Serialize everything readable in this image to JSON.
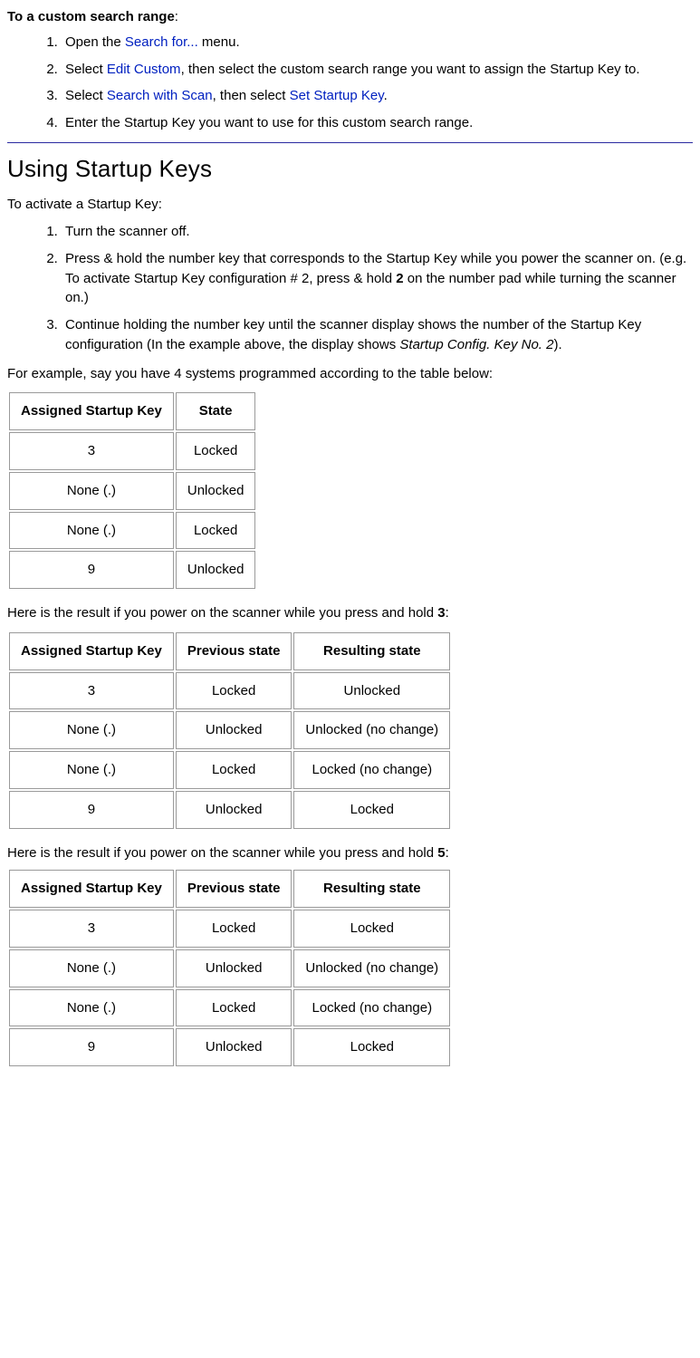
{
  "intro": {
    "heading_prefix": "To a custom search range",
    "heading_colon": ":",
    "steps": [
      {
        "parts": [
          {
            "t": "Open the "
          },
          {
            "t": "Search for...",
            "link": true
          },
          {
            "t": " menu."
          }
        ]
      },
      {
        "parts": [
          {
            "t": "Select "
          },
          {
            "t": "Edit Custom",
            "link": true
          },
          {
            "t": ", then select the custom search range you want to assign the Startup Key to."
          }
        ]
      },
      {
        "parts": [
          {
            "t": "Select "
          },
          {
            "t": "Search with Scan",
            "link": true
          },
          {
            "t": ", then select "
          },
          {
            "t": "Set Startup Key",
            "link": true
          },
          {
            "t": "."
          }
        ]
      },
      {
        "parts": [
          {
            "t": "Enter the Startup Key you want to use for this custom search range."
          }
        ]
      }
    ]
  },
  "section": {
    "title": "Using Startup Keys",
    "lead": "To activate a Startup Key:",
    "steps": [
      {
        "parts": [
          {
            "t": "Turn the scanner off."
          }
        ]
      },
      {
        "parts": [
          {
            "t": "Press & hold the number key that corresponds to the Startup Key while you power the scanner on. (e.g. To activate Startup Key configuration # 2, press & hold "
          },
          {
            "t": "2",
            "bold": true
          },
          {
            "t": " on the number pad while turning the scanner on.)"
          }
        ]
      },
      {
        "parts": [
          {
            "t": "Continue holding the number key until the scanner display shows the number of the Startup Key configuration (In the example above, the display shows "
          },
          {
            "t": "Startup Config. Key No. 2",
            "italic": true
          },
          {
            "t": ")."
          }
        ]
      }
    ]
  },
  "example_intro": "For example, say you have 4 systems programmed according to the table below:",
  "table1": {
    "headers": [
      "Assigned Startup Key",
      "State"
    ],
    "rows": [
      [
        "3",
        "Locked"
      ],
      [
        "None (.)",
        "Unlocked"
      ],
      [
        "None (.)",
        "Locked"
      ],
      [
        "9",
        "Unlocked"
      ]
    ]
  },
  "result3_intro_prefix": "Here is the result if you power on the scanner while you press and hold ",
  "result3_key": "3",
  "result3_suffix": ":",
  "table2": {
    "headers": [
      "Assigned Startup Key",
      "Previous state",
      "Resulting state"
    ],
    "rows": [
      [
        "3",
        "Locked",
        "Unlocked"
      ],
      [
        "None (.)",
        "Unlocked",
        "Unlocked (no change)"
      ],
      [
        "None (.)",
        "Locked",
        "Locked (no change)"
      ],
      [
        "9",
        "Unlocked",
        "Locked"
      ]
    ]
  },
  "result5_intro_prefix": "Here is the result if you power on the scanner while you press and hold ",
  "result5_key": "5",
  "result5_suffix": ":",
  "table3": {
    "headers": [
      "Assigned Startup Key",
      "Previous state",
      "Resulting state"
    ],
    "rows": [
      [
        "3",
        "Locked",
        "Locked"
      ],
      [
        "None (.)",
        "Unlocked",
        "Unlocked (no change)"
      ],
      [
        "None (.)",
        "Locked",
        "Locked (no change)"
      ],
      [
        "9",
        "Unlocked",
        "Locked"
      ]
    ]
  }
}
